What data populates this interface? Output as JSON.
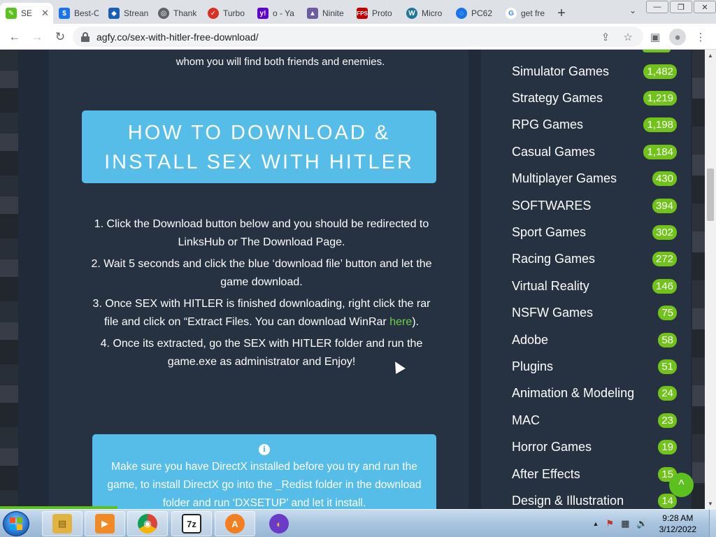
{
  "browser": {
    "tabs": [
      {
        "label": "SE",
        "favicon_color": "#5cc11e",
        "active": true
      },
      {
        "label": "Best-C",
        "favicon_color": "#1a73e8"
      },
      {
        "label": "Strean",
        "favicon_color": "#1a5fb4"
      },
      {
        "label": "Thank",
        "favicon_color": "#5f6368"
      },
      {
        "label": "Turbo",
        "favicon_color": "#d93025"
      },
      {
        "label": "o - Ya",
        "favicon_color": "#6001d2"
      },
      {
        "label": "Ninite",
        "favicon_color": "#6c5b9e"
      },
      {
        "label": "Proto",
        "favicon_color": "#c00000"
      },
      {
        "label": "Micro",
        "favicon_color": "#21759b"
      },
      {
        "label": "PC62",
        "favicon_color": "#1a73e8"
      },
      {
        "label": "get fre",
        "favicon_color": "#4285f4"
      }
    ],
    "tab_close": "✕",
    "new_tab": "+",
    "tab_dropdown": "⌄",
    "window_buttons": {
      "minimize": "—",
      "restore": "❐",
      "close": "✕"
    },
    "back": "←",
    "forward": "→",
    "reload": "↻",
    "url": "agfy.co/sex-with-hitler-free-download/",
    "share": "⇪",
    "bookmark": "☆",
    "sidepanel": "▣",
    "profile": "●",
    "menu": "⋮"
  },
  "content": {
    "intro_text": "whom you will find both friends and enemies.",
    "howto_title_line1": "HOW TO DOWNLOAD &",
    "howto_title_line2": "INSTALL SEX WITH HITLER",
    "steps": [
      "1. Click the Download button below and you should be redirected to LinksHub or The Download Page.",
      "2. Wait 5 seconds and click the blue ‘download file’ button and let the game download.",
      "3. Once SEX with HITLER is finished downloading, right click the rar file and click on “Extract Files. You can download WinRar ",
      "4. Once its extracted, go the SEX with HITLER folder and run the game.exe as administrator and Enjoy!"
    ],
    "step3_link": "here",
    "step3_end": ").",
    "info_icon": "i",
    "info_text": "Make sure you have DirectX installed before you try and run the game, to install DirectX go into the _Redist folder in the download folder and run ‘DXSETUP’ and let it install.",
    "scroll_top_icon": "^"
  },
  "categories": [
    {
      "name": "Simulator Games",
      "count": "1,482"
    },
    {
      "name": "Strategy Games",
      "count": "1,219"
    },
    {
      "name": "RPG Games",
      "count": "1,198"
    },
    {
      "name": "Casual Games",
      "count": "1,184"
    },
    {
      "name": "Multiplayer Games",
      "count": "430"
    },
    {
      "name": "SOFTWARES",
      "count": "394"
    },
    {
      "name": "Sport Games",
      "count": "302"
    },
    {
      "name": "Racing Games",
      "count": "272"
    },
    {
      "name": "Virtual Reality",
      "count": "146"
    },
    {
      "name": "NSFW Games",
      "count": "75"
    },
    {
      "name": "Adobe",
      "count": "58"
    },
    {
      "name": "Plugins",
      "count": "51"
    },
    {
      "name": "Animation & Modeling",
      "count": "24"
    },
    {
      "name": "MAC",
      "count": "23"
    },
    {
      "name": "Horror Games",
      "count": "19"
    },
    {
      "name": "After Effects",
      "count": "15"
    },
    {
      "name": "Design & Illustration",
      "count": "14"
    }
  ],
  "scrollbar": {
    "up": "▲",
    "down": "▼"
  },
  "taskbar": {
    "apps": [
      {
        "name": "explorer",
        "glyph": "▤",
        "color": "#e3b341"
      },
      {
        "name": "media-player",
        "glyph": "▶",
        "color": "#f08a24"
      },
      {
        "name": "chrome",
        "glyph": "◉",
        "color": "#db4437"
      },
      {
        "name": "7zip",
        "glyph": "7z",
        "color": "#222222"
      },
      {
        "name": "avast",
        "glyph": "A",
        "color": "#f47f20"
      },
      {
        "name": "vpn",
        "glyph": "◐",
        "color": "#6a3bc9"
      }
    ],
    "tray": {
      "arrow": "▲",
      "flag": "⚑",
      "network": "▦",
      "volume": "🔊"
    },
    "time": "9:28 AM",
    "date": "3/12/2022"
  },
  "colors": {
    "accent_blue": "#55bde8",
    "badge_green": "#72c21c",
    "page_bg": "#263142"
  }
}
